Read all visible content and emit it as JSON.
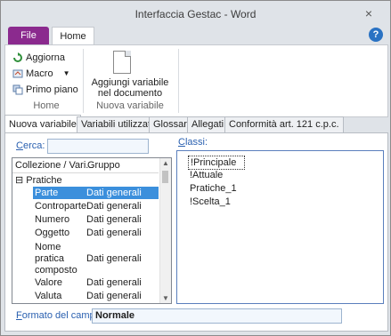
{
  "window": {
    "title": "Interfaccia Gestac - Word",
    "close_glyph": "×"
  },
  "ribbon_tabs": {
    "file": "File",
    "home": "Home"
  },
  "help_glyph": "?",
  "ribbon": {
    "aggiorna": "Aggiorna",
    "macro": "Macro",
    "primo_piano": "Primo piano",
    "group_home": "Home",
    "aggiungi_line1": "Aggiungi variabile",
    "aggiungi_line2": "nel documento",
    "group_nuova": "Nuova variabile"
  },
  "panel_tabs": [
    "Nuova variabile",
    "Variabili utilizzate",
    "Glossari",
    "Allegati",
    "Conformità art. 121 c.p.c."
  ],
  "search": {
    "label_u": "C",
    "label_rest": "erca:",
    "value": ""
  },
  "grid": {
    "col1": "Collezione / Vari...",
    "col2": "Gruppo",
    "tree_root": "Pratiche",
    "tree_toggle": "⊟",
    "rows": [
      {
        "name": "Parte",
        "group": "Dati generali"
      },
      {
        "name": "Controparte",
        "group": "Dati generali"
      },
      {
        "name": "Numero",
        "group": "Dati generali"
      },
      {
        "name": "Oggetto",
        "group": "Dati generali"
      },
      {
        "name": "Nome",
        "group": ""
      },
      {
        "name": "pratica",
        "group": "Dati generali"
      },
      {
        "name": "composto",
        "group": ""
      },
      {
        "name": "Valore",
        "group": "Dati generali"
      },
      {
        "name": "Valuta",
        "group": "Dati generali"
      }
    ]
  },
  "classes": {
    "label_u": "C",
    "label_rest": "lassi:",
    "items": [
      "!Principale",
      "!Attuale",
      "Pratiche_1",
      "!Scelta_1"
    ]
  },
  "format": {
    "label_u": "F",
    "label_rest": "ormato del campo:",
    "value": "Normale"
  },
  "colors": {
    "file_tab": "#8b2a8e",
    "selection": "#3b8fdc",
    "accent_text": "#2a60b0"
  }
}
